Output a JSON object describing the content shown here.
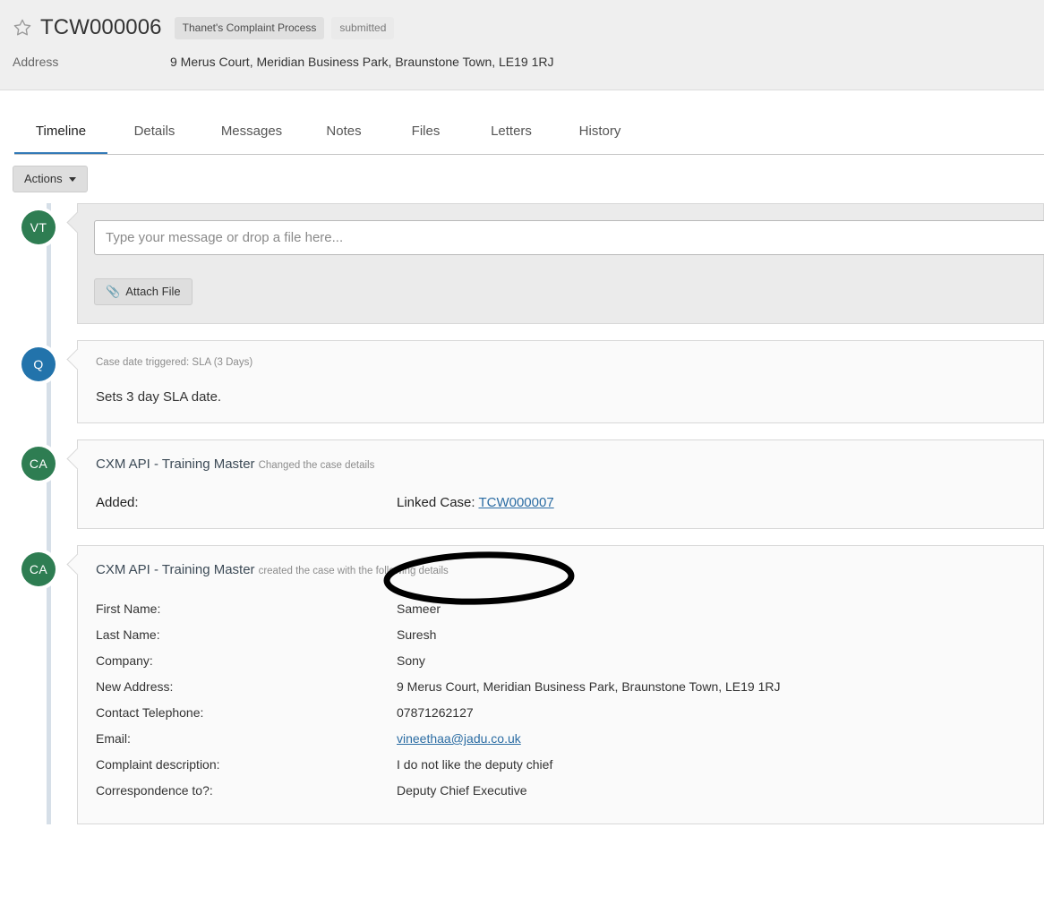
{
  "header": {
    "star_icon": "star-outline-icon",
    "case_reference": "TCW000006",
    "process_badge": "Thanet's Complaint Process",
    "status_badge": "submitted",
    "address_label": "Address",
    "address_value": "9 Merus Court, Meridian Business Park, Braunstone Town, LE19 1RJ"
  },
  "tabs": [
    {
      "label": "Timeline",
      "active": true
    },
    {
      "label": "Details",
      "active": false
    },
    {
      "label": "Messages",
      "active": false
    },
    {
      "label": "Notes",
      "active": false
    },
    {
      "label": "Files",
      "active": false
    },
    {
      "label": "Letters",
      "active": false
    },
    {
      "label": "History",
      "active": false
    }
  ],
  "toolbar": {
    "actions_label": "Actions"
  },
  "composer": {
    "avatar_initials": "VT",
    "avatar_color": "#2e7d52",
    "placeholder": "Type your message or drop a file here...",
    "value": "",
    "attach_label": "Attach File",
    "attach_icon": "paperclip-icon"
  },
  "timeline": [
    {
      "avatar_initials": "Q",
      "avatar_color": "#2273ab",
      "subtitle": "Case date triggered: SLA (3 Days)",
      "body": "Sets 3 day SLA date."
    },
    {
      "avatar_initials": "CA",
      "avatar_color": "#2e7d52",
      "who": "CXM API - Training Master",
      "what": "Changed the case details",
      "added_label": "Added:",
      "linked_case_prefix": "Linked Case:",
      "linked_case_value": "TCW000007",
      "annotated": true
    },
    {
      "avatar_initials": "CA",
      "avatar_color": "#2e7d52",
      "who": "CXM API - Training Master",
      "what": "created the case with the following details",
      "details": [
        {
          "key": "First Name:",
          "value": "Sameer",
          "link": false
        },
        {
          "key": "Last Name:",
          "value": "Suresh",
          "link": false
        },
        {
          "key": "Company:",
          "value": "Sony",
          "link": false
        },
        {
          "key": "New Address:",
          "value": "9 Merus Court, Meridian Business Park, Braunstone Town, LE19 1RJ",
          "link": false
        },
        {
          "key": "Contact Telephone:",
          "value": "07871262127",
          "link": false
        },
        {
          "key": "Email:",
          "value": "vineethaa@jadu.co.uk",
          "link": true
        },
        {
          "key": "Complaint description:",
          "value": "I do not like the deputy chief",
          "link": false
        },
        {
          "key": "Correspondence to?:",
          "value": "Deputy Chief Executive",
          "link": false
        }
      ]
    }
  ],
  "colors": {
    "accent": "#337ab7",
    "avatar_green": "#2e7d52",
    "avatar_blue": "#2273ab",
    "annotation": "#000000",
    "rail": "#d6dfe8"
  }
}
